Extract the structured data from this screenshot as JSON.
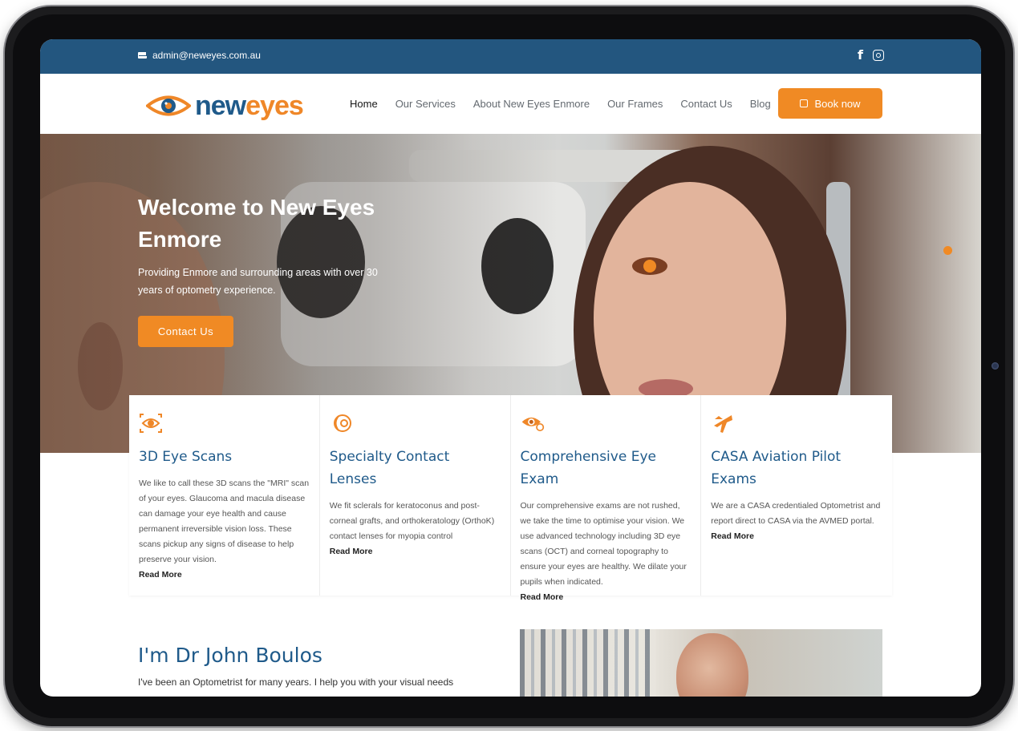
{
  "topbar": {
    "email": "admin@neweyes.com.au",
    "social": [
      "facebook-icon",
      "instagram-icon"
    ]
  },
  "logo": {
    "part1": "new",
    "part2": "eyes"
  },
  "nav": {
    "items": [
      "Home",
      "Our Services",
      "About New Eyes Enmore",
      "Our Frames",
      "Contact Us",
      "Blog"
    ],
    "active": "Home",
    "book_label": "Book now"
  },
  "hero": {
    "title": "Welcome to New Eyes Enmore",
    "subtitle": "Providing Enmore and surrounding areas with over 30 years of optometry experience.",
    "cta": "Contact Us"
  },
  "cards": [
    {
      "icon": "eye-scan-icon",
      "title": "3D Eye Scans",
      "text": "We like to call these 3D scans the \"MRI\" scan of your eyes. Glaucoma and macula disease can damage your eye health and cause permanent irreversible vision loss. These scans pickup any signs of disease to help preserve your vision.",
      "more": "Read More"
    },
    {
      "icon": "contact-lens-icon",
      "title": "Specialty Contact Lenses",
      "text": "We fit sclerals for keratoconus and post-corneal grafts, and orthokeratology (OrthoK) contact lenses for myopia control",
      "more": "Read More"
    },
    {
      "icon": "eye-exam-icon",
      "title": "Comprehensive Eye Exam",
      "text": "Our comprehensive exams are not rushed, we take the time to optimise your vision. We use advanced technology including 3D eye scans (OCT) and corneal topography to ensure your eyes are healthy. We dilate your pupils when indicated.",
      "more": "Read More"
    },
    {
      "icon": "airplane-icon",
      "title": "CASA Aviation Pilot Exams",
      "text": "We are a CASA credentialed Optometrist and report direct to CASA via the AVMED portal.",
      "more": "Read More"
    }
  ],
  "about": {
    "heading": "I'm Dr John Boulos",
    "text": "I've been an Optometrist for many years. I help you with your visual needs"
  },
  "colors": {
    "primary": "#23567f",
    "accent": "#f08a24",
    "heading": "#1f5a8a"
  }
}
